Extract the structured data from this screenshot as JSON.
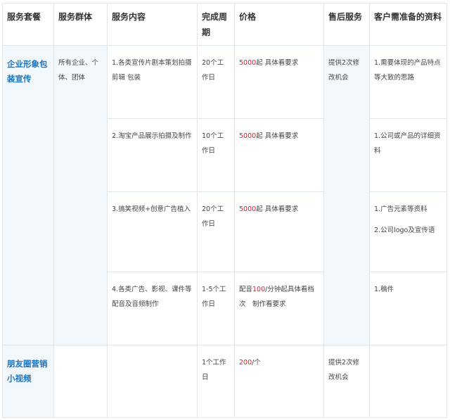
{
  "headers": [
    "服务套餐",
    "服务群体",
    "服务内容",
    "完成周期",
    "价格",
    "售后服务",
    "客户需准备的资料"
  ],
  "rows": [
    {
      "category": "企业形象包装宣传",
      "group": "所有企业、个体、团体",
      "content": "1.各类宣传片剧本策划拍摄剪辑 包装",
      "period": "20个工作日",
      "price_red": "5000",
      "price_rest": "起 具体看要求",
      "after": "提供2次修改机会",
      "materials": [
        "1.需要体现的产品特点等大致的思路"
      ]
    },
    {
      "content": "2.淘宝产品展示拍摄及制作",
      "period": "10个工作日",
      "price_red": "5000",
      "price_rest": "起 具体看要求",
      "materials": [
        "1.公司或产品的详细资料"
      ]
    },
    {
      "content": "3.搞笑视频+创意广告植入",
      "period": "20个工作日",
      "price_red": "5000",
      "price_rest": "起 具体看要求",
      "materials": [
        "1.广告元素等资料",
        "2.公司logo及宣传语"
      ]
    },
    {
      "content": "4.各类广告、影视、课件等配音及音频制作",
      "period": "1-5个工作日",
      "price_pre": "配音",
      "price_red": "100",
      "price_rest": "/分钟起具体看档次　制作看要求",
      "materials": [
        "1.稿件"
      ]
    },
    {
      "category": "朋友圈营销小视频",
      "group": "",
      "content": "",
      "period": "1个工作日",
      "price_red": "200",
      "price_rest": "/个",
      "after": "提供2次修改机会",
      "materials": []
    }
  ]
}
